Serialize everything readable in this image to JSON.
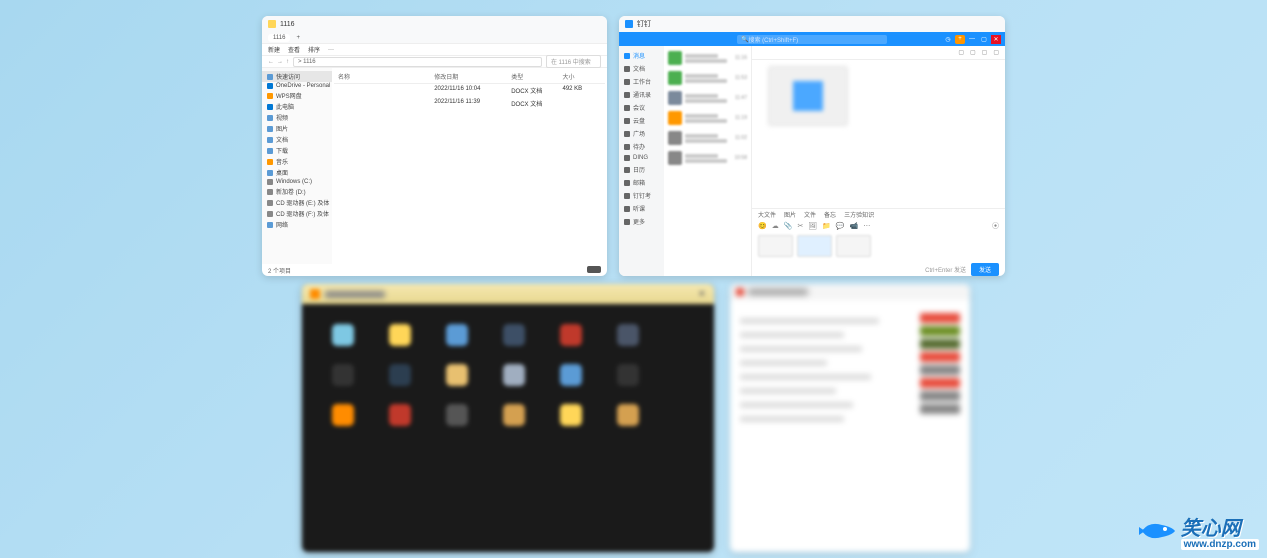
{
  "explorer": {
    "title": "1116",
    "tab": "1116",
    "toolbar": {
      "new": "新建",
      "view": "查看",
      "sort": "排序",
      "more": "···"
    },
    "nav": {
      "arrows_back": "←",
      "arrows_fwd": "→",
      "arrows_up": "↑",
      "breadcrumb": "> 1116",
      "search": "在 1116 中搜索"
    },
    "sidebar": [
      {
        "label": "快速访问",
        "color": "#5b9bd5"
      },
      {
        "label": "OneDrive - Personal",
        "color": "#0078d4"
      },
      {
        "label": "WPS网盘",
        "color": "#ff9800"
      },
      {
        "label": "此电脑",
        "color": "#0078d4"
      },
      {
        "label": "视频",
        "color": "#5b9bd5"
      },
      {
        "label": "图片",
        "color": "#5b9bd5"
      },
      {
        "label": "文档",
        "color": "#5b9bd5"
      },
      {
        "label": "下载",
        "color": "#5b9bd5"
      },
      {
        "label": "音乐",
        "color": "#ff9800"
      },
      {
        "label": "桌面",
        "color": "#5b9bd5"
      },
      {
        "label": "Windows (C:)",
        "color": "#888"
      },
      {
        "label": "新加卷 (D:)",
        "color": "#888"
      },
      {
        "label": "CD 驱动器 (E:) 及体",
        "color": "#888"
      },
      {
        "label": "CD 驱动器 (F:) 及体",
        "color": "#888"
      },
      {
        "label": "网络",
        "color": "#5b9bd5"
      }
    ],
    "columns": {
      "name": "名称",
      "date": "修改日期",
      "type": "类型",
      "size": "大小"
    },
    "rows": [
      {
        "date": "2022/11/16 10:04",
        "type": "DOCX 文档",
        "size": "492 KB"
      },
      {
        "date": "2022/11/16 11:39",
        "type": "DOCX 文档",
        "size": ""
      }
    ],
    "footer": "2 个项目"
  },
  "dingtalk": {
    "title": "钉钉",
    "search_placeholder": "搜索 (Ctrl+Shift+F)",
    "win_min": "—",
    "win_max": "▢",
    "win_close": "✕",
    "nav": [
      {
        "label": "消息",
        "active": true
      },
      {
        "label": "文档",
        "active": false
      },
      {
        "label": "工作台",
        "active": false
      },
      {
        "label": "通讯录",
        "active": false
      },
      {
        "label": "会议",
        "active": false
      },
      {
        "label": "云盘",
        "active": false
      },
      {
        "label": "广场",
        "active": false
      },
      {
        "label": "待办",
        "active": false
      },
      {
        "label": "DING",
        "active": false
      },
      {
        "label": "日历",
        "active": false
      },
      {
        "label": "邮箱",
        "active": false
      },
      {
        "label": "钉钉考",
        "active": false
      },
      {
        "label": "听课",
        "active": false
      },
      {
        "label": "更多",
        "active": false
      }
    ],
    "chat_times": [
      "11:16",
      "11:53",
      "11:47",
      "11:19",
      "11:02",
      "10:58"
    ],
    "avatar_colors": [
      "#4caf50",
      "#4caf50",
      "#7b8a9c",
      "#ff9800",
      "#888",
      "#888"
    ],
    "header_icons": [
      "chat-icon",
      "contact-icon",
      "group-icon",
      "more-icon"
    ],
    "tabs": [
      "大文件",
      "图片",
      "文件",
      "备忘",
      "三方验知识"
    ],
    "compose_icons": [
      "😊",
      "☁",
      "📎",
      "✂",
      "🖼",
      "📁",
      "💬",
      "📹",
      "⋯"
    ],
    "send_hint": "Ctrl+Enter 发送",
    "send": "发送"
  },
  "dark_window": {
    "tile_colors": [
      "#7ec8e3",
      "#ffd658",
      "#5b9bd5",
      "#3d4f66",
      "#c0392b",
      "#4a5568",
      "#333",
      "#2c3e50",
      "#e8c070",
      "#a0aec0",
      "#5b9bd5",
      "#333",
      "#ff8c00",
      "#c0392b",
      "#555",
      "#d4a050",
      "#ffd658",
      "#d4a050"
    ]
  },
  "light_window": {
    "right_colors": [
      "#e74c3c",
      "#6b8e23",
      "#556b2f",
      "#e74c3c",
      "#888",
      "#e74c3c",
      "#888",
      "#888"
    ]
  },
  "watermark": {
    "brand": "笑心网",
    "url": "www.dnzp.com"
  }
}
